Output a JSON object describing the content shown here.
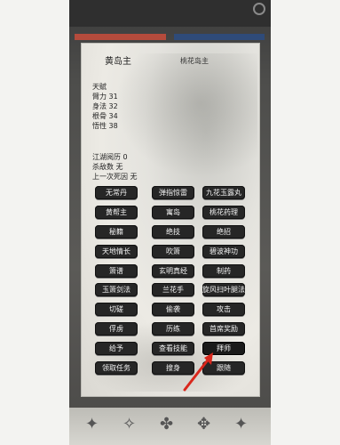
{
  "top_bar": {
    "left_text": "",
    "right_text": ""
  },
  "profile": {
    "name": "黄岛主",
    "subtitle": "桃花岛主"
  },
  "stats": [
    "天赋",
    "臂力 31",
    "身法 32",
    "根骨 34",
    "悟性 38"
  ],
  "jianghu": [
    "江湖阅历 0",
    "杀敌数 无",
    "上一次死因 无"
  ],
  "buttons": [
    [
      "无常丹",
      "弹指惊雷",
      "九花玉露丸"
    ],
    [
      "黄帮主",
      "寓岛",
      "桃花药理"
    ],
    [
      "秘籍",
      "绝技",
      "绝招"
    ],
    [
      "天地情长",
      "吹箫",
      "碧波神功"
    ],
    [
      "箫谱",
      "玄明真经",
      "制药"
    ],
    [
      "玉箫剑法",
      "兰花手",
      "旋风扫叶腿法"
    ],
    [
      "切磋",
      "偷袭",
      "攻击"
    ],
    [
      "俘虏",
      "历练",
      "首席奖励"
    ],
    [
      "给予",
      "查看技能",
      "拜师"
    ],
    [
      "领取任务",
      "搜身",
      "跟随"
    ]
  ],
  "highlight": "拜师",
  "arrow_color": "#d9271c"
}
